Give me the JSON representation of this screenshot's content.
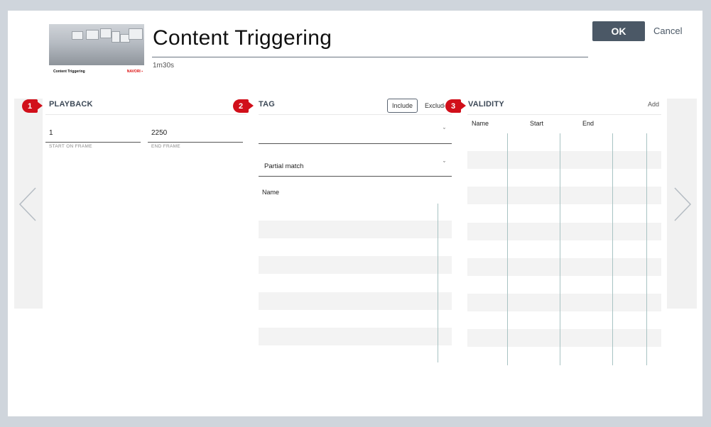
{
  "header": {
    "title": "Content Triggering",
    "duration": "1m30s",
    "thumbnail_caption": "Content Triggering",
    "thumbnail_brand": "NAVORI",
    "ok_label": "OK",
    "cancel_label": "Cancel"
  },
  "playback": {
    "badge": "1",
    "heading": "PLAYBACK",
    "start_value": "1",
    "start_label": "START ON FRAME",
    "end_value": "2250",
    "end_label": "END FRAME"
  },
  "tag": {
    "badge": "2",
    "heading": "TAG",
    "include_label": "Include",
    "exclude_label": "Exclude",
    "tag_select_value": "",
    "match_select_value": "Partial match",
    "name_column": "Name"
  },
  "validity": {
    "badge": "3",
    "heading": "VALIDITY",
    "add_label": "Add",
    "columns": [
      "Name",
      "Start",
      "End"
    ]
  },
  "colors": {
    "accent": "#4b5866",
    "badge": "#d10f1a",
    "stripe": "#f3f3f3"
  },
  "icons": {
    "prev": "chevron-left-icon",
    "next": "chevron-right-icon",
    "dropdown": "chevron-down-icon"
  }
}
